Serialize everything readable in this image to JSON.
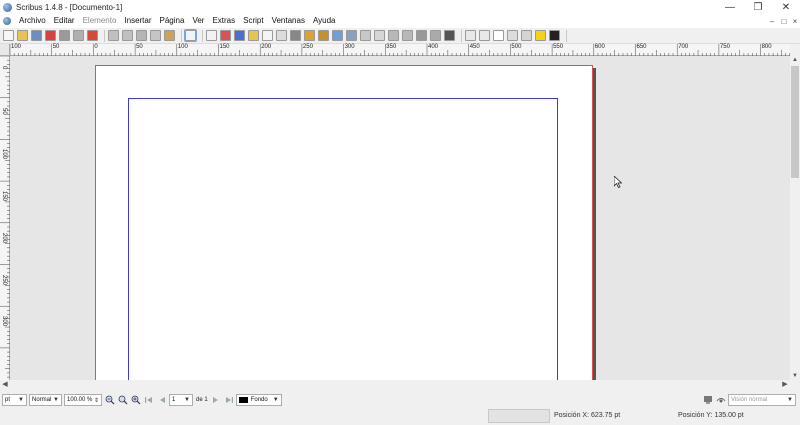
{
  "window": {
    "title": "Scribus 1.4.8 - [Documento-1]",
    "minimize_icon": "minimize-icon",
    "maximize_icon": "restore-icon",
    "close_icon": "close-icon"
  },
  "menu": {
    "items": [
      {
        "label": "Archivo",
        "enabled": true
      },
      {
        "label": "Editar",
        "enabled": true
      },
      {
        "label": "Elemento",
        "enabled": false
      },
      {
        "label": "Insertar",
        "enabled": true
      },
      {
        "label": "Página",
        "enabled": true
      },
      {
        "label": "Ver",
        "enabled": true
      },
      {
        "label": "Extras",
        "enabled": true
      },
      {
        "label": "Script",
        "enabled": true
      },
      {
        "label": "Ventanas",
        "enabled": true
      },
      {
        "label": "Ayuda",
        "enabled": true
      }
    ]
  },
  "toolbar": {
    "icons": [
      {
        "name": "new-document-icon",
        "color": "#f6f6f6"
      },
      {
        "name": "open-folder-icon",
        "color": "#e8c253"
      },
      {
        "name": "save-icon",
        "color": "#6b8fbf"
      },
      {
        "name": "close-document-icon",
        "color": "#d94040"
      },
      {
        "name": "print-icon",
        "color": "#9a9a9a"
      },
      {
        "name": "preflight-icon",
        "color": "#b0b0b0"
      },
      {
        "name": "export-pdf-icon",
        "color": "#d64a3a"
      },
      {
        "name": "undo-icon",
        "color": "#c0c0c0"
      },
      {
        "name": "redo-icon",
        "color": "#c0c0c0"
      },
      {
        "name": "cut-icon",
        "color": "#b5b5b5"
      },
      {
        "name": "copy-icon",
        "color": "#c5c5c5"
      },
      {
        "name": "paste-icon",
        "color": "#caa35a"
      },
      {
        "name": "select-icon",
        "color": "#eef4fb"
      },
      {
        "name": "text-frame-icon",
        "color": "#f2f2f2"
      },
      {
        "name": "image-frame-icon",
        "color": "#d9534f"
      },
      {
        "name": "render-frame-icon",
        "color": "#4a6fd0"
      },
      {
        "name": "table-icon",
        "color": "#e6c44d"
      },
      {
        "name": "shape-icon",
        "color": "#f4f4f4"
      },
      {
        "name": "polygon-icon",
        "color": "#dcdcdc"
      },
      {
        "name": "line-icon",
        "color": "#888888"
      },
      {
        "name": "bezier-icon",
        "color": "#e0a030"
      },
      {
        "name": "freehand-icon",
        "color": "#c89028"
      },
      {
        "name": "rotate-icon",
        "color": "#6f9fd8"
      },
      {
        "name": "zoom-icon",
        "color": "#8aa0c0"
      },
      {
        "name": "edit-contents-icon",
        "color": "#c8c8c8"
      },
      {
        "name": "edit-text-icon",
        "color": "#d6d6d6"
      },
      {
        "name": "link-frames-icon",
        "color": "#b8b8b8"
      },
      {
        "name": "unlink-frames-icon",
        "color": "#b8b8b8"
      },
      {
        "name": "measure-icon",
        "color": "#999999"
      },
      {
        "name": "copy-properties-icon",
        "color": "#aaaaaa"
      },
      {
        "name": "eyedropper-icon",
        "color": "#555555"
      },
      {
        "name": "pdf-push-button-icon",
        "color": "#e8e8e8"
      },
      {
        "name": "pdf-text-field-icon",
        "color": "#e8e8e8"
      },
      {
        "name": "pdf-checkbox-icon",
        "color": "#ffffff"
      },
      {
        "name": "pdf-combo-box-icon",
        "color": "#dcdcdc"
      },
      {
        "name": "pdf-list-box-icon",
        "color": "#d4d4d4"
      },
      {
        "name": "text-annotation-icon",
        "color": "#f2d21a"
      },
      {
        "name": "link-annotation-icon",
        "color": "#222222"
      }
    ]
  },
  "ruler": {
    "h_labels": [
      "100",
      "50",
      "0",
      "50",
      "100",
      "150",
      "200",
      "250",
      "300",
      "350",
      "400",
      "450",
      "500",
      "550",
      "600",
      "650",
      "700",
      "750",
      "800"
    ],
    "v_labels": [
      "0",
      "50",
      "100",
      "150",
      "200",
      "250",
      "300"
    ]
  },
  "bottom": {
    "unit": "pt",
    "mode": "Normal",
    "zoom": "100.00 %",
    "page_current": "1",
    "page_of": "de 1",
    "layer_color": "#000000",
    "layer_name": "Fondo",
    "view_mode": "Visión normal"
  },
  "status": {
    "pos_x": "Posición X:  623.75 pt",
    "pos_y": "Posición Y:  135.00 pt"
  },
  "colors": {
    "page_border": "#e05050",
    "margin_guide": "#3a3adc",
    "canvas_bg": "#e6e6e6"
  }
}
